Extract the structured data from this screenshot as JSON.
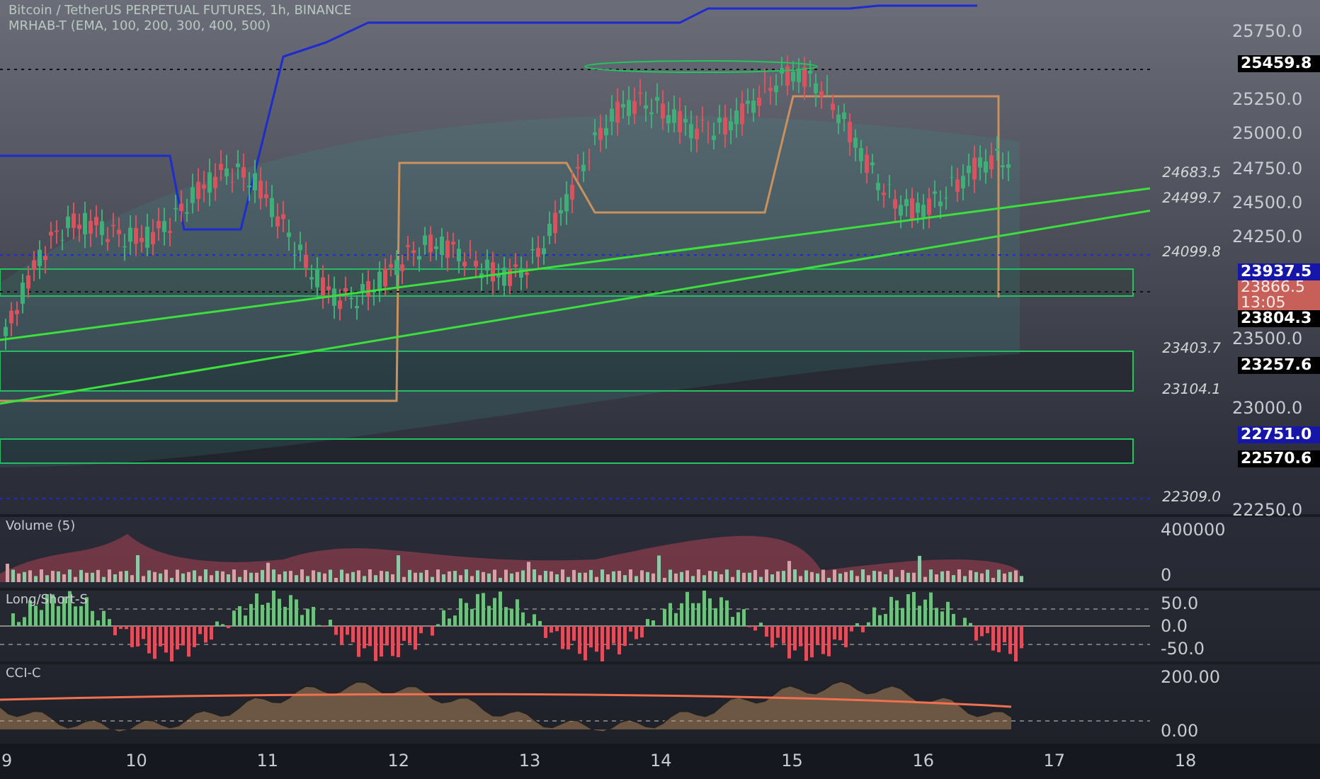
{
  "header": {
    "symbol_line": "Bitcoin / TetherUS PERPETUAL FUTURES, 1h, BINANCE",
    "indicator_line": "MRHAB-T (EMA, 100, 200, 300, 400, 500)"
  },
  "price_axis": {
    "ticks": [
      "25750.0",
      "25250.0",
      "25000.0",
      "24750.0",
      "24500.0",
      "24250.0",
      "23500.0",
      "23000.0",
      "22250.0"
    ]
  },
  "level_labels": [
    "24683.5",
    "24499.7",
    "24099.8",
    "23403.7",
    "23104.1",
    "22309.0"
  ],
  "price_tags": [
    {
      "text": "25459.8",
      "kind": "dark"
    },
    {
      "text": "23937.5",
      "kind": "blue"
    },
    {
      "text": "23866.5",
      "countdown": "13:05",
      "kind": "last"
    },
    {
      "text": "23804.3",
      "kind": "dark"
    },
    {
      "text": "23257.6",
      "kind": "dark"
    },
    {
      "text": "22751.0",
      "kind": "blue"
    },
    {
      "text": "22570.6",
      "kind": "dark"
    }
  ],
  "panels": [
    {
      "kind": "volume",
      "title": "Volume (5)",
      "ticks": [
        "400000",
        "0"
      ]
    },
    {
      "kind": "longshort",
      "title": "Long/Short-S",
      "ticks": [
        "50.0",
        "0.0",
        "-50.0"
      ]
    },
    {
      "kind": "cci",
      "title": "CCI-C",
      "ticks": [
        "200.00",
        "0.00"
      ]
    }
  ],
  "time_axis": [
    "9",
    "10",
    "11",
    "12",
    "13",
    "14",
    "15",
    "16",
    "17",
    "18"
  ]
}
